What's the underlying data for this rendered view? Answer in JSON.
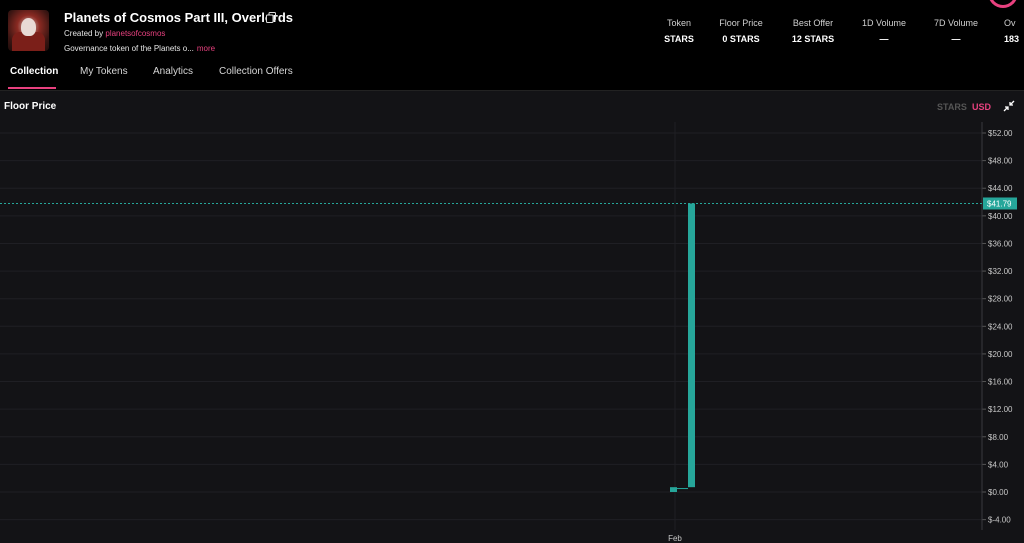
{
  "collection": {
    "title": "Planets of Cosmos Part III, Overlords",
    "creator_prefix": "Created by",
    "creator_name": "planetsofcosmos",
    "description": "Governance token of the Planets o...",
    "more_label": "more"
  },
  "stats": [
    {
      "label": "Token",
      "value": "STARS"
    },
    {
      "label": "Floor Price",
      "value": "0 STARS"
    },
    {
      "label": "Best Offer",
      "value": "12 STARS"
    },
    {
      "label": "1D Volume",
      "value": "—"
    },
    {
      "label": "7D Volume",
      "value": "—"
    },
    {
      "label": "Ov",
      "value": "183 "
    }
  ],
  "tabs": [
    {
      "label": "Collection",
      "active": true
    },
    {
      "label": "My Tokens",
      "active": false
    },
    {
      "label": "Analytics",
      "active": false
    },
    {
      "label": "Collection Offers",
      "active": false
    }
  ],
  "panel": {
    "title": "Floor Price",
    "currency_options": [
      "STARS",
      "USD"
    ],
    "selected_currency": "USD"
  },
  "colors": {
    "accent": "#e8417f",
    "candle": "#26a69a",
    "background": "#000000",
    "panel": "#131316"
  },
  "icons": {
    "copy": "copy-icon",
    "collapse": "collapse-icon"
  },
  "chart_data": {
    "type": "bar",
    "title": "",
    "ylim": [
      -4,
      54
    ],
    "y_ticks": [
      "$52.00",
      "$48.00",
      "$44.00",
      "$40.00",
      "$36.00",
      "$32.00",
      "$28.00",
      "$24.00",
      "$20.00",
      "$16.00",
      "$12.00",
      "$8.00",
      "$4.00",
      "$0.00",
      "$-4.00"
    ],
    "y_tick_values": [
      52,
      48,
      44,
      40,
      36,
      32,
      28,
      24,
      20,
      16,
      12,
      8,
      4,
      0,
      -4
    ],
    "x_ticks": [
      "Feb"
    ],
    "series": [
      {
        "values": [
          {
            "open": 0.0,
            "close": 0.7
          },
          {
            "open": 0.7,
            "close": 41.79
          }
        ]
      }
    ],
    "last_price_label": "$41.79",
    "last_price": 41.79,
    "grid": true
  }
}
